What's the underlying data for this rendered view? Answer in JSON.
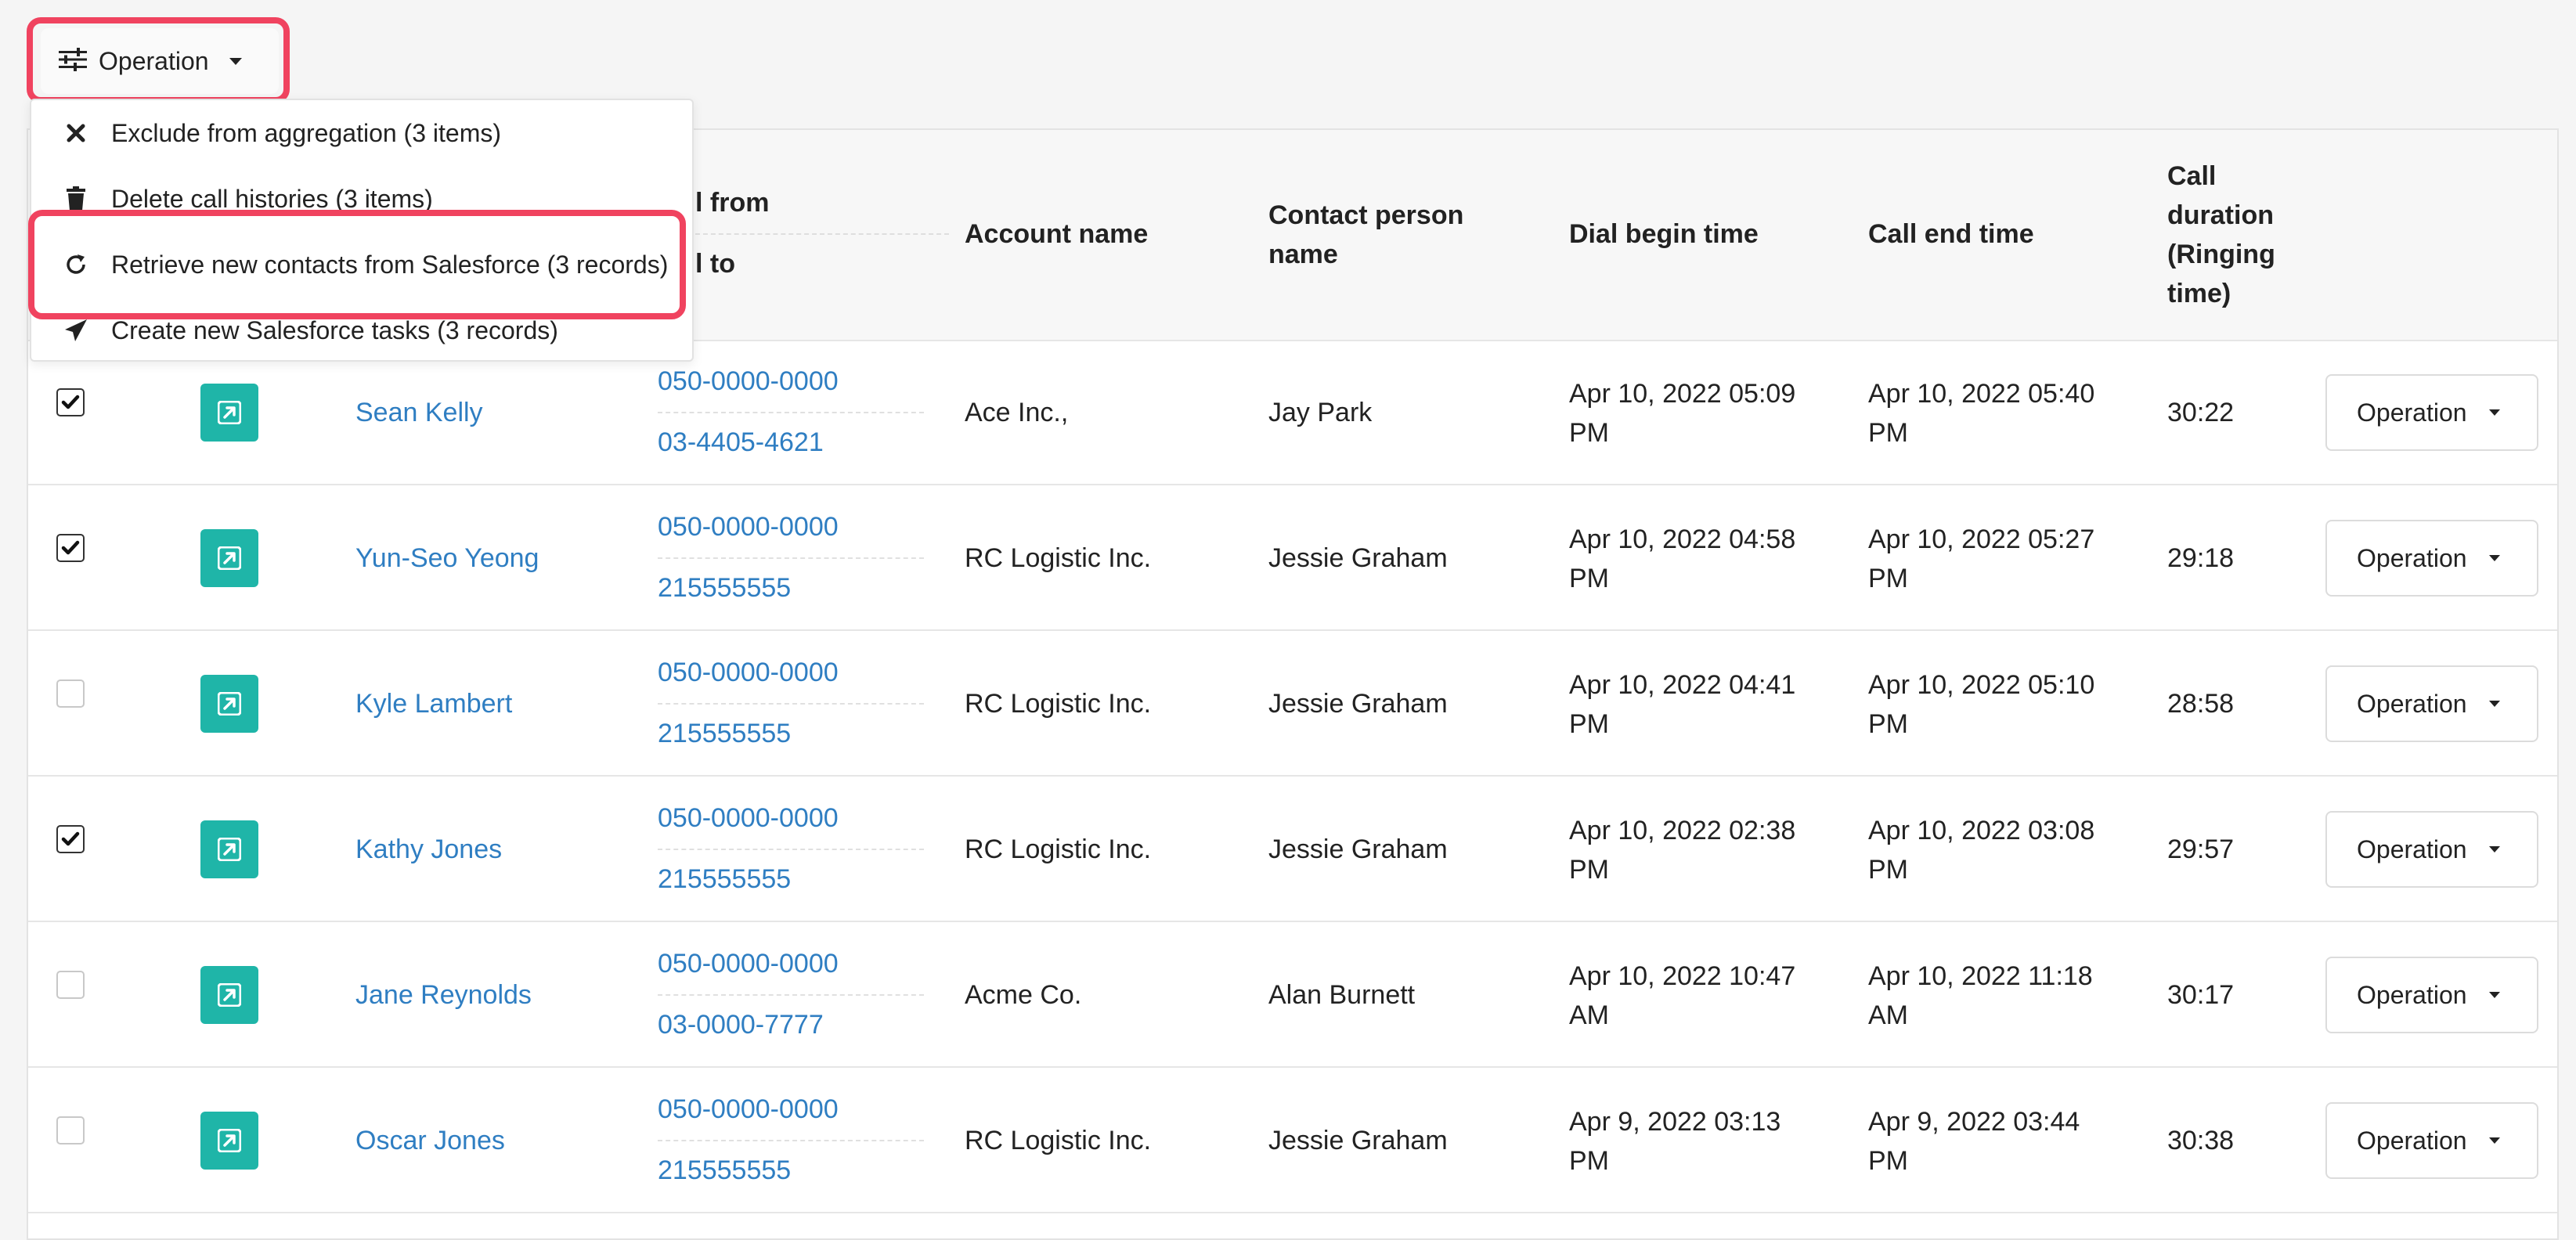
{
  "toolbar": {
    "operation_label": "Operation"
  },
  "menu": {
    "items": [
      {
        "label": "Exclude from aggregation (3 items)",
        "icon": "x-icon"
      },
      {
        "label": "Delete call histories (3 items)",
        "icon": "trash-icon"
      },
      {
        "label": "Retrieve new contacts from Salesforce (3 records)",
        "icon": "refresh-icon"
      },
      {
        "label": "Create new Salesforce tasks (3 records)",
        "icon": "send-icon"
      }
    ]
  },
  "table": {
    "headers": {
      "call_from": "l from",
      "call_to": "l to",
      "account": "Account name",
      "contact_line1": "Contact person",
      "contact_line2": "name",
      "dial_begin": "Dial begin time",
      "call_end": "Call end time",
      "duration_line1": "Call",
      "duration_line2": "duration",
      "duration_line3": "(Ringing",
      "duration_line4": "time)"
    },
    "rows": [
      {
        "checked": true,
        "name": "Sean Kelly",
        "from": "050-0000-0000",
        "to": "03-4405-4621",
        "account": "Ace Inc.,",
        "contact": "Jay Park",
        "begin1": "Apr 10, 2022 05:09",
        "begin2": "PM",
        "end1": "Apr 10, 2022 05:40",
        "end2": "PM",
        "duration": "30:22",
        "op": "Operation"
      },
      {
        "checked": true,
        "name": "Yun-Seo Yeong",
        "from": "050-0000-0000",
        "to": "215555555",
        "account": "RC Logistic Inc.",
        "contact": "Jessie Graham",
        "begin1": "Apr 10, 2022 04:58",
        "begin2": "PM",
        "end1": "Apr 10, 2022 05:27",
        "end2": "PM",
        "duration": "29:18",
        "op": "Operation"
      },
      {
        "checked": false,
        "name": "Kyle Lambert",
        "from": "050-0000-0000",
        "to": "215555555",
        "account": "RC Logistic Inc.",
        "contact": "Jessie Graham",
        "begin1": "Apr 10, 2022 04:41",
        "begin2": "PM",
        "end1": "Apr 10, 2022 05:10",
        "end2": "PM",
        "duration": "28:58",
        "op": "Operation"
      },
      {
        "checked": true,
        "name": "Kathy Jones",
        "from": "050-0000-0000",
        "to": "215555555",
        "account": "RC Logistic Inc.",
        "contact": "Jessie Graham",
        "begin1": "Apr 10, 2022 02:38",
        "begin2": "PM",
        "end1": "Apr 10, 2022 03:08",
        "end2": "PM",
        "duration": "29:57",
        "op": "Operation"
      },
      {
        "checked": false,
        "name": "Jane Reynolds",
        "from": "050-0000-0000",
        "to": "03-0000-7777",
        "account": "Acme Co.",
        "contact": "Alan Burnett",
        "begin1": "Apr 10, 2022 10:47",
        "begin2": "AM",
        "end1": "Apr 10, 2022 11:18",
        "end2": "AM",
        "duration": "30:17",
        "op": "Operation"
      },
      {
        "checked": false,
        "name": "Oscar Jones",
        "from": "050-0000-0000",
        "to": "215555555",
        "account": "RC Logistic Inc.",
        "contact": "Jessie Graham",
        "begin1": "Apr 9, 2022 03:13",
        "begin2": "PM",
        "end1": "Apr 9, 2022 03:44",
        "end2": "PM",
        "duration": "30:38",
        "op": "Operation"
      }
    ]
  },
  "colors": {
    "link": "#2f7ec2",
    "accent_teal": "#1fb5a8",
    "highlight": "#f0435f"
  }
}
